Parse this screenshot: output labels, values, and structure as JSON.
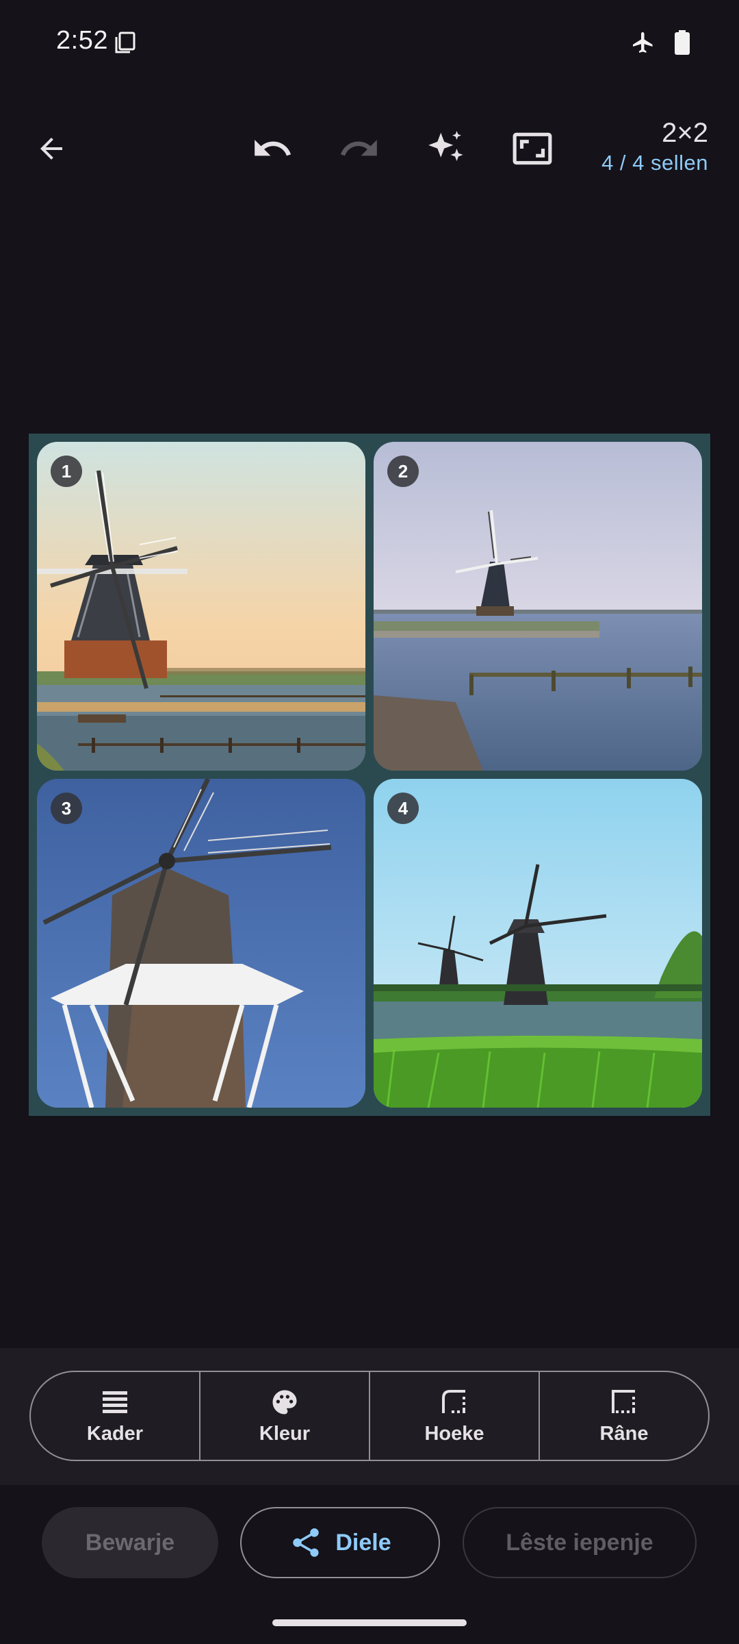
{
  "status_bar": {
    "time": "2:52"
  },
  "toolbar": {
    "icons": [
      "back-arrow-icon",
      "undo-icon",
      "redo-icon",
      "auto-fix-sparkle-icon",
      "aspect-ratio-icon"
    ],
    "grid_size": "2×2",
    "cells_filled": "4 / 4 sellen"
  },
  "collage": {
    "cells": [
      {
        "number": "1"
      },
      {
        "number": "2"
      },
      {
        "number": "3"
      },
      {
        "number": "4"
      }
    ]
  },
  "options": {
    "items": [
      {
        "label": "Kader",
        "icon": "layout-icon"
      },
      {
        "label": "Kleur",
        "icon": "palette-icon"
      },
      {
        "label": "Hoeke",
        "icon": "corners-icon"
      },
      {
        "label": "Râne",
        "icon": "borders-icon"
      }
    ]
  },
  "actions": {
    "save_label": "Bewarje",
    "share_label": "Diele",
    "recent_label": "Lêste iepenje"
  },
  "colors": {
    "background": "#151219",
    "accent": "#8ecbf8",
    "collage_border": "#2a4a50"
  }
}
